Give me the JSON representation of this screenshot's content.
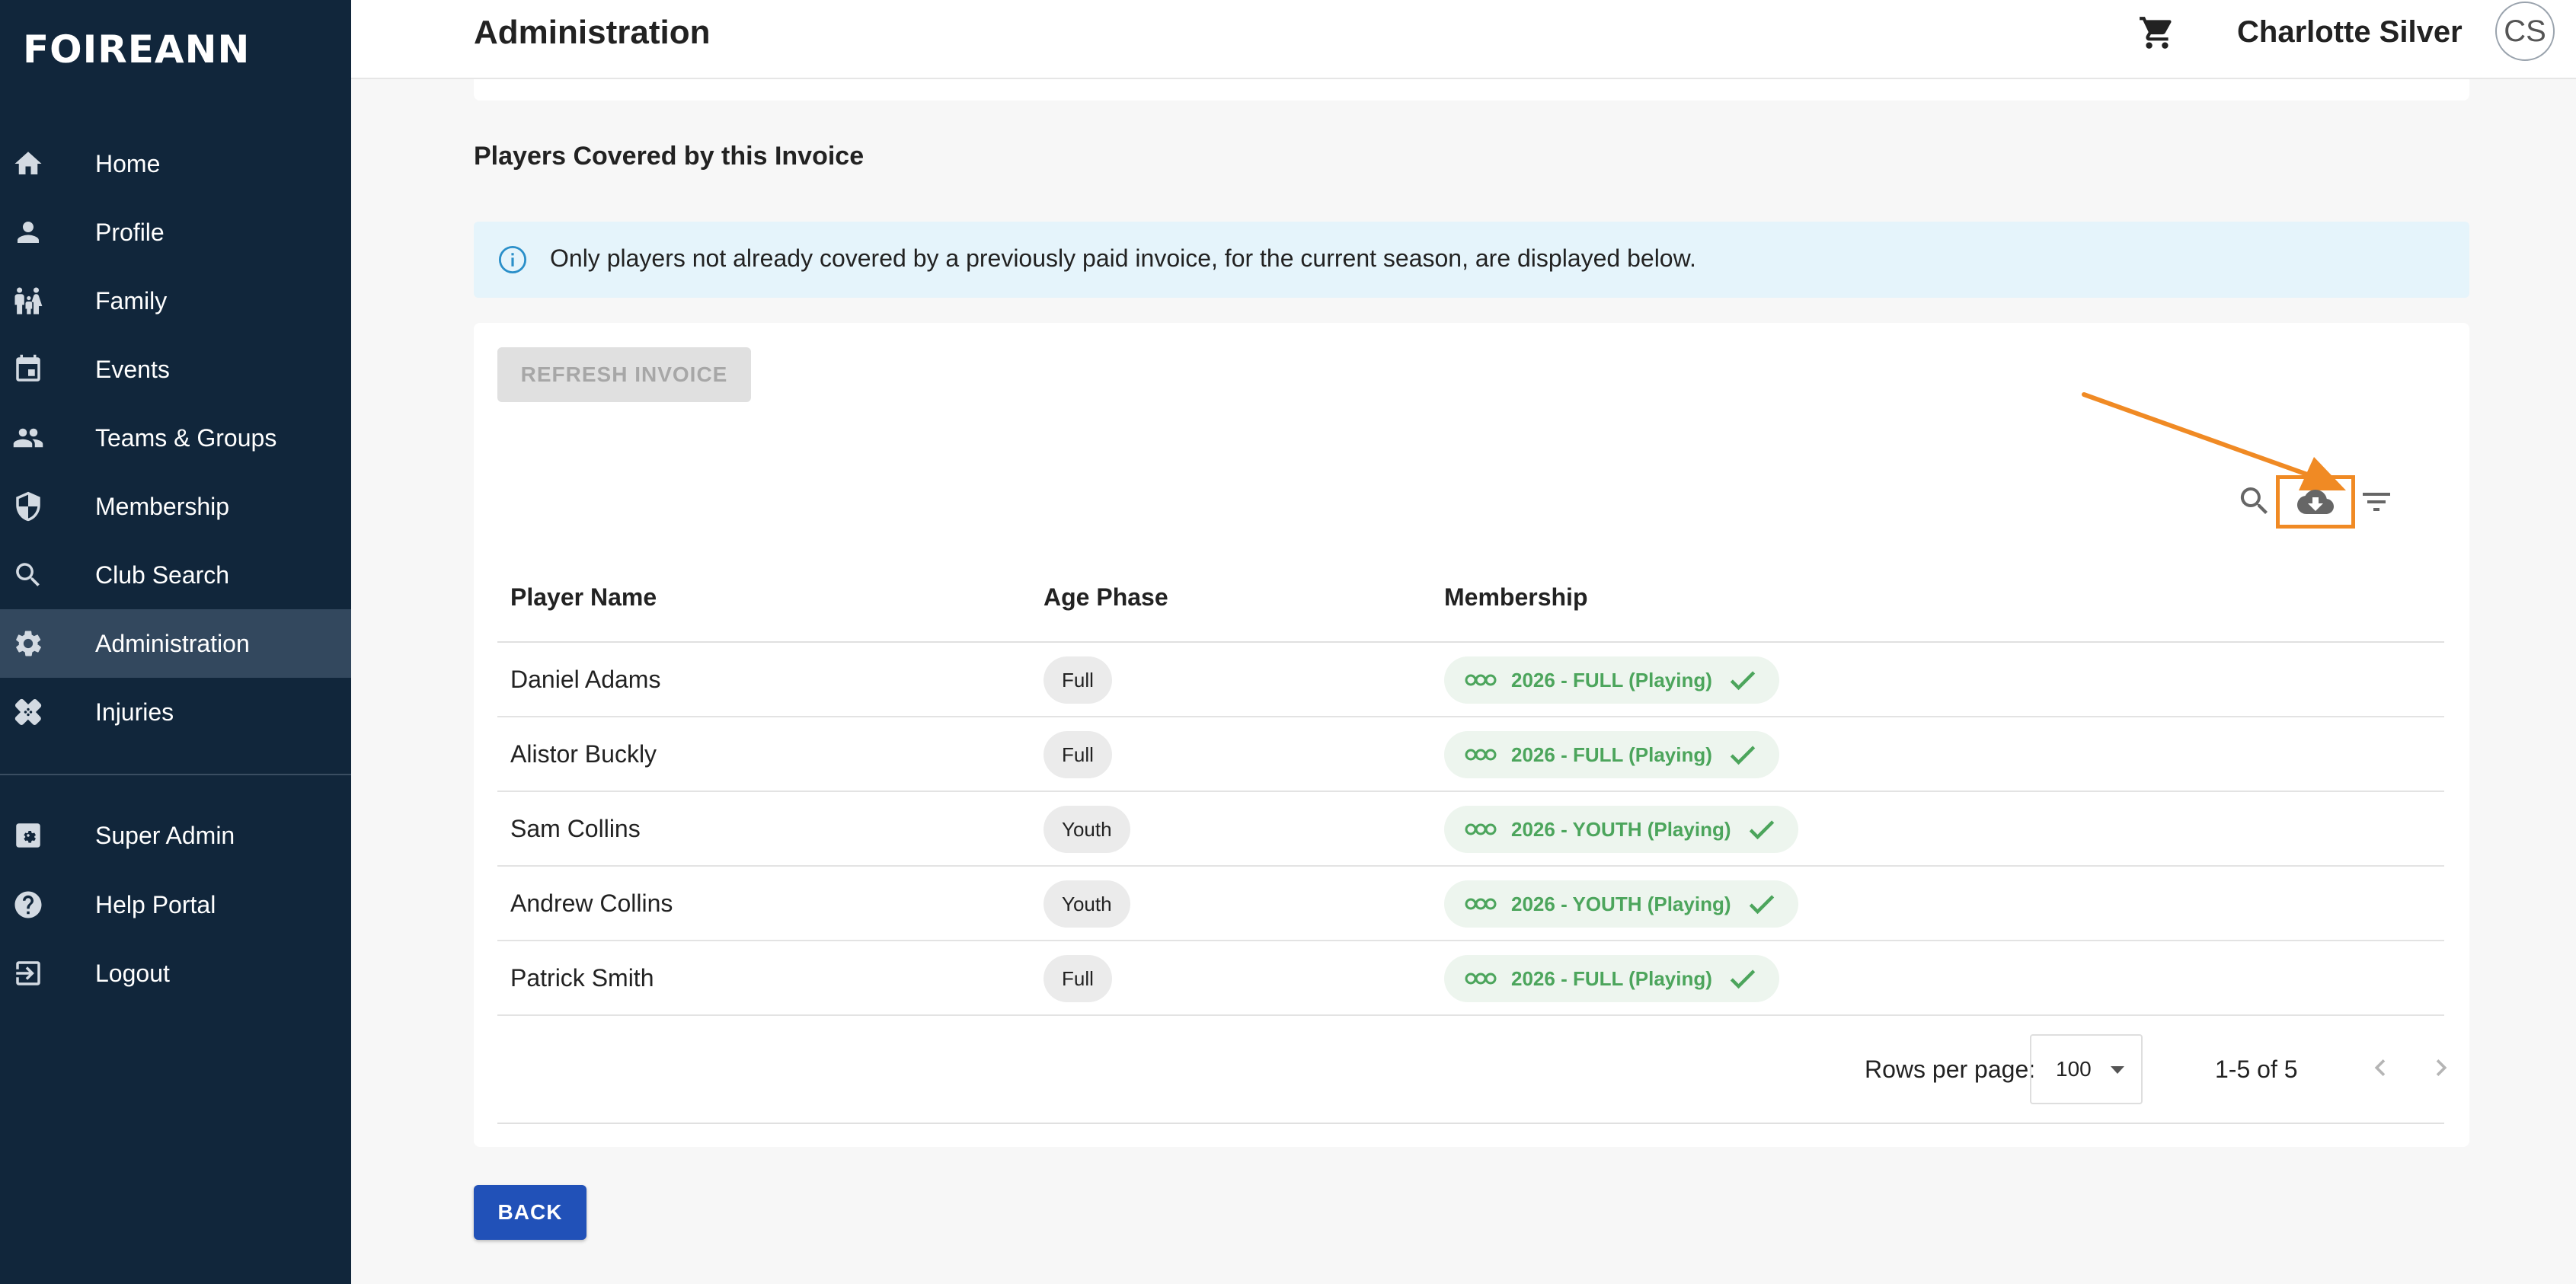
{
  "sidebar": {
    "logo": "FOIREANN",
    "items": [
      {
        "label": "Home",
        "icon": "home-icon"
      },
      {
        "label": "Profile",
        "icon": "person-icon"
      },
      {
        "label": "Family",
        "icon": "family-icon"
      },
      {
        "label": "Events",
        "icon": "calendar-icon"
      },
      {
        "label": "Teams & Groups",
        "icon": "group-icon"
      },
      {
        "label": "Membership",
        "icon": "shield-icon"
      },
      {
        "label": "Club Search",
        "icon": "search-icon"
      },
      {
        "label": "Administration",
        "icon": "gear-icon",
        "active": true
      },
      {
        "label": "Injuries",
        "icon": "bandage-icon"
      },
      {
        "label": "Super Admin",
        "icon": "admin-gear-icon"
      },
      {
        "label": "Help Portal",
        "icon": "help-icon"
      },
      {
        "label": "Logout",
        "icon": "logout-icon"
      }
    ],
    "active_color": "#33485e",
    "background": "#11263b"
  },
  "header": {
    "title": "Administration",
    "cart_icon": "cart-icon",
    "user_name": "Charlotte Silver",
    "avatar_initials": "CS"
  },
  "section": {
    "title": "Players Covered by this Invoice",
    "info_text": "Only players not already covered by a previously paid invoice, for the current season, are displayed below."
  },
  "toolbar": {
    "refresh_label": "REFRESH INVOICE",
    "search_icon": "search-icon",
    "download_icon": "cloud-download-icon",
    "filter_icon": "filter-icon",
    "highlight_color": "#f08a24"
  },
  "table": {
    "columns": [
      "Player Name",
      "Age Phase",
      "Membership"
    ],
    "rows": [
      {
        "name": "Daniel Adams",
        "age_phase": "Full",
        "membership": "2026 - FULL (Playing)"
      },
      {
        "name": "Alistor Buckly",
        "age_phase": "Full",
        "membership": "2026 - FULL (Playing)"
      },
      {
        "name": "Sam Collins",
        "age_phase": "Youth",
        "membership": "2026 - YOUTH (Playing)"
      },
      {
        "name": "Andrew Collins",
        "age_phase": "Youth",
        "membership": "2026 - YOUTH (Playing)"
      },
      {
        "name": "Patrick Smith",
        "age_phase": "Full",
        "membership": "2026 - FULL (Playing)"
      }
    ],
    "membership_color": "#4ca55c"
  },
  "pagination": {
    "rows_per_page_label": "Rows per page:",
    "rows_per_page_value": "100",
    "range": "1-5 of 5"
  },
  "footer": {
    "back_label": "BACK",
    "back_color": "#2151b8"
  }
}
